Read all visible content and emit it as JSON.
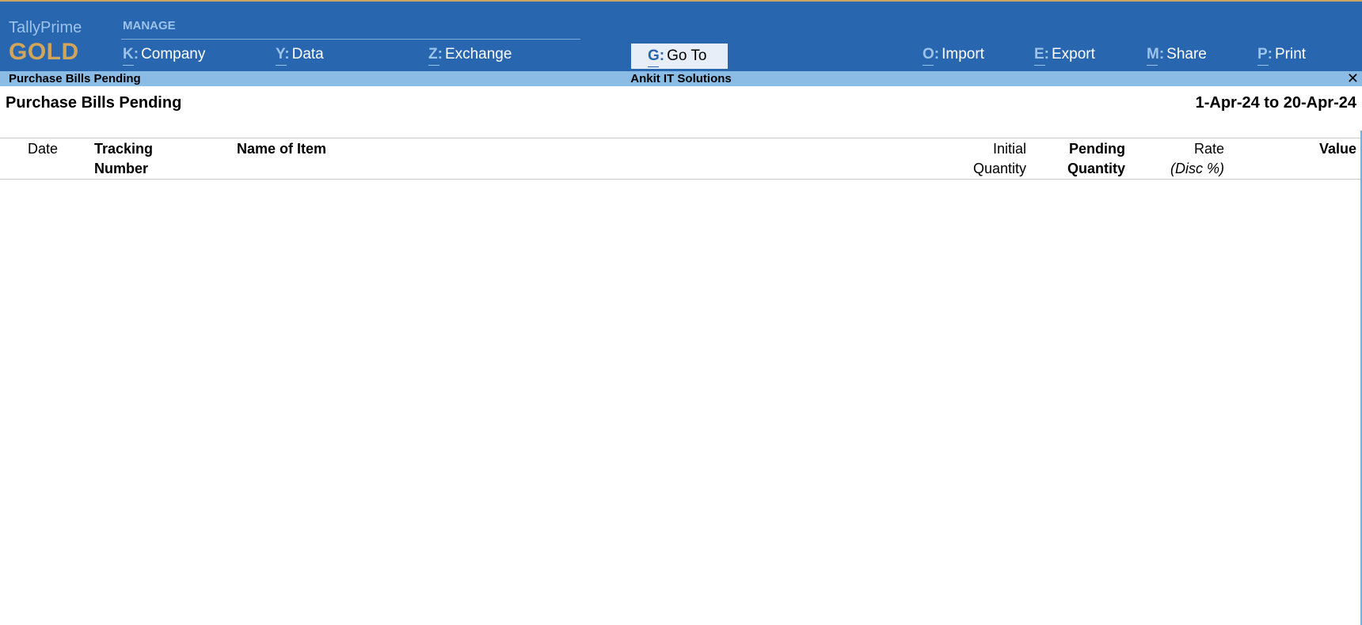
{
  "header": {
    "brand_name": "TallyPrime",
    "brand_edition": "GOLD",
    "manage_label": "MANAGE",
    "menu": [
      {
        "key": "K:",
        "label": "Company"
      },
      {
        "key": "Y:",
        "label": "Data"
      },
      {
        "key": "Z:",
        "label": "Exchange"
      },
      {
        "key": "G:",
        "label": "Go To"
      },
      {
        "key": "O:",
        "label": "Import"
      },
      {
        "key": "E:",
        "label": "Export"
      },
      {
        "key": "M:",
        "label": "Share"
      },
      {
        "key": "P:",
        "label": "Print"
      }
    ]
  },
  "subbar": {
    "screen_title": "Purchase Bills Pending",
    "company": "Ankit IT Solutions",
    "close_glyph": "✕"
  },
  "report": {
    "title": "Purchase Bills Pending",
    "period": "1-Apr-24 to 20-Apr-24",
    "columns": {
      "date": "Date",
      "tracking_1": "Tracking",
      "tracking_2": "Number",
      "item": "Name of Item",
      "initial_1": "Initial",
      "initial_2": "Quantity",
      "pending_1": "Pending",
      "pending_2": "Quantity",
      "rate_1": "Rate",
      "rate_2": "(Disc %)",
      "value": "Value"
    },
    "rows": []
  },
  "colors": {
    "topbar": "#2966b0",
    "subbar": "#8abce6",
    "brand_gold": "#d1a55a",
    "brand_light": "#9cc3ea"
  }
}
